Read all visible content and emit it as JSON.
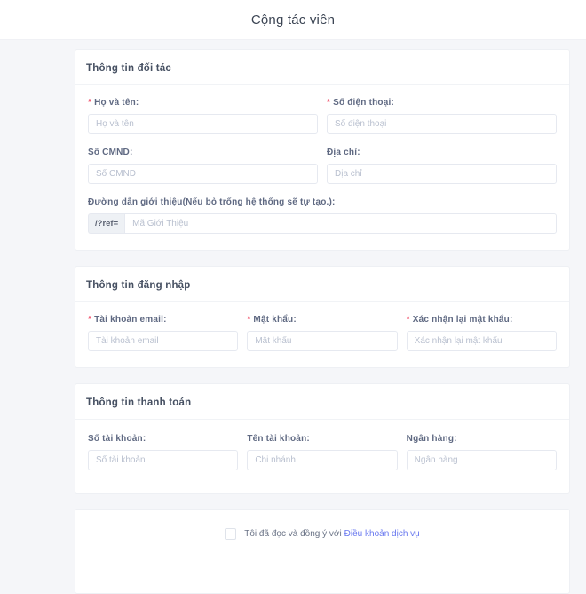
{
  "page": {
    "title": "Cộng tác viên"
  },
  "required_marker": "*",
  "colors": {
    "link": "#6777ef",
    "required": "#f0506a"
  },
  "sections": {
    "partner": {
      "title": "Thông tin đối tác",
      "fields": {
        "name": {
          "label": "Họ và tên:",
          "placeholder": "Họ và tên",
          "required": true,
          "value": ""
        },
        "phone": {
          "label": "Số điện thoại:",
          "placeholder": "Số điện thoại",
          "required": true,
          "value": ""
        },
        "id_number": {
          "label": "Số CMND:",
          "placeholder": "Số CMND",
          "required": false,
          "value": ""
        },
        "address": {
          "label": "Địa chỉ:",
          "placeholder": "Địa chỉ",
          "required": false,
          "value": ""
        },
        "referral": {
          "label": "Đường dẫn giới thiệu(Nếu bỏ trống hệ thống sẽ tự tạo.):",
          "prefix": "/?ref=",
          "placeholder": "Mã Giới Thiệu",
          "required": false,
          "value": ""
        }
      }
    },
    "login": {
      "title": "Thông tin đăng nhập",
      "fields": {
        "email": {
          "label": "Tài khoản email:",
          "placeholder": "Tài khoản email",
          "required": true,
          "value": ""
        },
        "password": {
          "label": "Mật khẩu:",
          "placeholder": "Mật khẩu",
          "required": true,
          "value": ""
        },
        "confirm": {
          "label": "Xác nhận lại mật khẩu:",
          "placeholder": "Xác nhận lại mật khẩu",
          "required": true,
          "value": ""
        }
      }
    },
    "payment": {
      "title": "Thông tin thanh toán",
      "fields": {
        "account_number": {
          "label": "Số tài khoản:",
          "placeholder": "Số tài khoản",
          "required": false,
          "value": ""
        },
        "account_name": {
          "label": "Tên tài khoản:",
          "placeholder": "Chi nhánh",
          "required": false,
          "value": ""
        },
        "bank": {
          "label": "Ngân hàng:",
          "placeholder": "Ngân hàng",
          "required": false,
          "value": ""
        }
      }
    },
    "terms": {
      "agree_text": "Tôi đã đọc và đồng ý với",
      "link_text": "Điều khoản dịch vụ",
      "checked": false
    }
  }
}
